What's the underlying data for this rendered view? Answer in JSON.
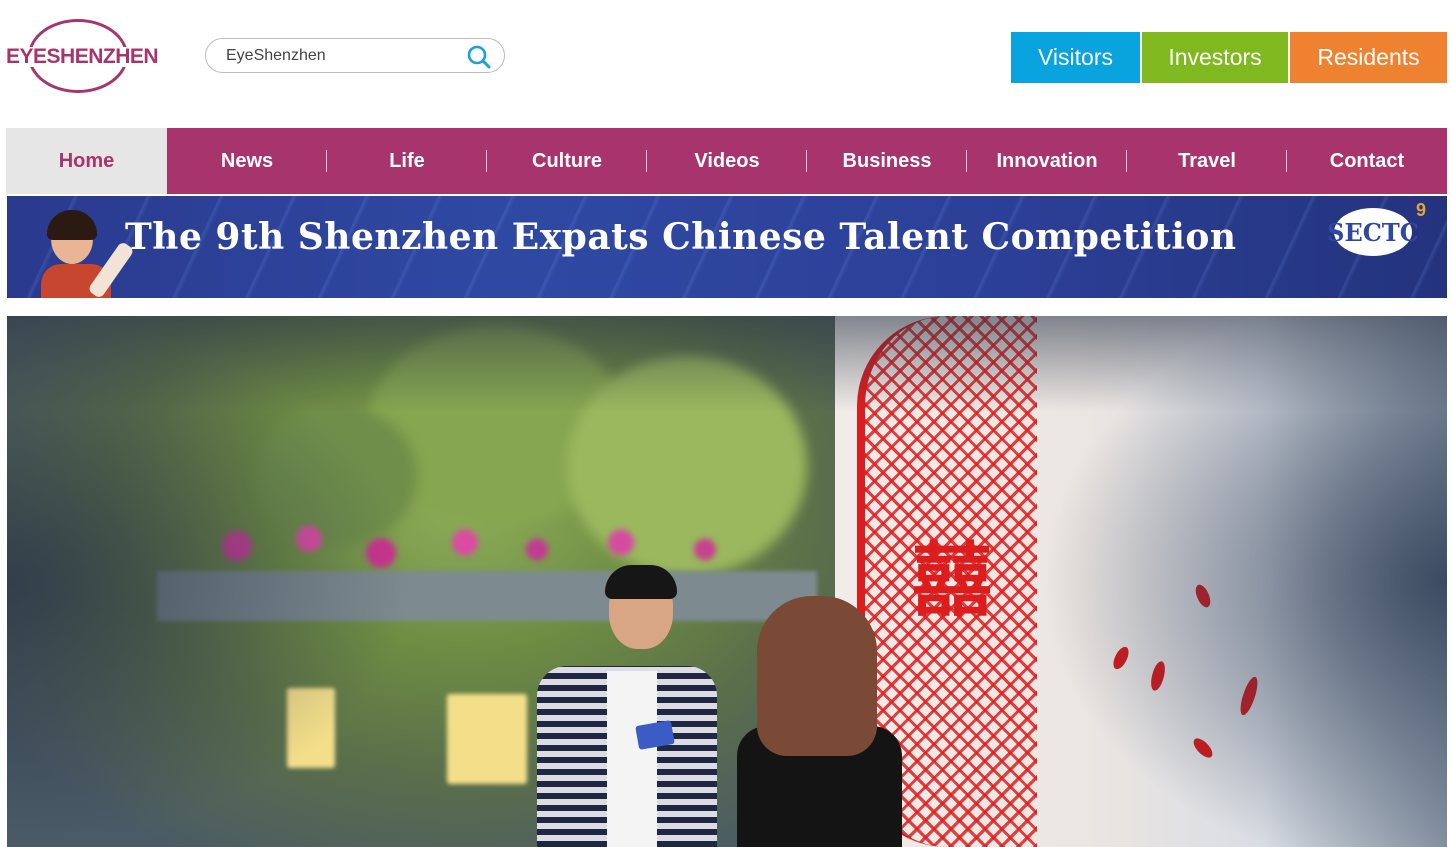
{
  "header": {
    "logo_text": "EYESHENZHEN",
    "search": {
      "value": "EyeShenzhen",
      "icon": "search-icon"
    },
    "audience": [
      {
        "label": "Visitors",
        "color": "#09a3dd"
      },
      {
        "label": "Investors",
        "color": "#7fb81f"
      },
      {
        "label": "Residents",
        "color": "#ef8230"
      }
    ]
  },
  "nav": {
    "active": "Home",
    "items": [
      "Home",
      "News",
      "Life",
      "Culture",
      "Videos",
      "Business",
      "Innovation",
      "Travel",
      "Contact"
    ],
    "colors": {
      "bar": "#a8346e",
      "active_bg": "#e6e6e6"
    }
  },
  "banner": {
    "title": "The 9th Shenzhen Expats Chinese Talent Competition",
    "emblem_text": "SECTC",
    "emblem_superscript": "9"
  },
  "hero": {
    "description_icon": "photo-image",
    "papercut_character": "囍"
  }
}
